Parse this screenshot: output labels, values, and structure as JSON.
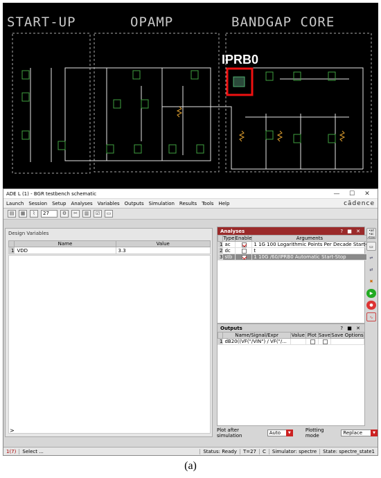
{
  "schematic": {
    "sections": [
      "START-UP",
      "OPAMP",
      "BANDGAP CORE"
    ],
    "highlight_label": "IPRB0"
  },
  "window": {
    "title": "ADE L (1) - BGR testbench schematic",
    "controls": [
      "—",
      "☐",
      "✕"
    ]
  },
  "menu": {
    "items": [
      "Launch",
      "Session",
      "Setup",
      "Analyses",
      "Variables",
      "Outputs",
      "Simulation",
      "Results",
      "Tools",
      "Help"
    ],
    "brand": "cādence"
  },
  "toolbar": {
    "temperature": "27"
  },
  "design_variables": {
    "caption": "Design Variables",
    "columns": [
      "Name",
      "Value"
    ],
    "rows": [
      {
        "num": "1",
        "name": "VDD",
        "value": "3.3"
      }
    ],
    "arrow": ">"
  },
  "analyses": {
    "title": "Analyses",
    "header_controls": "? ■ ✕",
    "columns": [
      "Type",
      "Enable",
      "Arguments"
    ],
    "rows": [
      {
        "num": "1",
        "type": "ac",
        "enabled": true,
        "args": "1 1G 100 Logarithmic Points Per Decade Start-"
      },
      {
        "num": "2",
        "type": "dc",
        "enabled": false,
        "args": "t"
      },
      {
        "num": "3",
        "type": "stb",
        "enabled": true,
        "args": "1 10G /60/IPRB0 Automatic Start-Stop",
        "selected": true
      }
    ]
  },
  "outputs": {
    "title": "Outputs",
    "header_controls": "? ■ ✕",
    "columns": [
      "Name/Signal/Expr",
      "Value",
      "Plot",
      "Save",
      "Save Options"
    ],
    "rows": [
      {
        "num": "1",
        "expr": "dB20((VF(\"/VIN\") / VF(\"/...",
        "value": ""
      }
    ]
  },
  "bottom": {
    "plot_after_label": "Plot after simulation",
    "plot_after_value": "Auto",
    "plotting_mode_label": "Plotting mode",
    "plotting_mode_value": "Replace"
  },
  "status_bar": {
    "left": "1(7)",
    "msg": "Select ...",
    "status": "Status: Ready",
    "temp": "T=27",
    "unit": "C",
    "simulator": "Simulator: spectre",
    "state": "State: spectre_state1"
  },
  "caption": "(a)",
  "colors": {
    "accent_red": "#cc1111",
    "panel_header": "#9a2a2a"
  }
}
